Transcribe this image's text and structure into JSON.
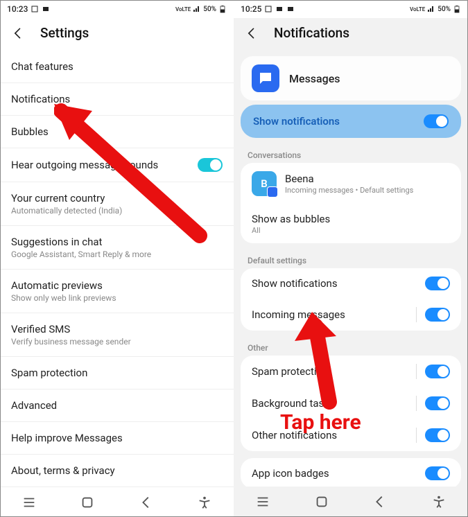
{
  "left": {
    "status": {
      "time": "10:23",
      "battery": "50%"
    },
    "header_title": "Settings",
    "rows": [
      {
        "label": "Chat features"
      },
      {
        "label": "Notifications"
      },
      {
        "label": "Bubbles"
      },
      {
        "label": "Hear outgoing message sounds",
        "toggle": true
      },
      {
        "label": "Your current country",
        "sub": "Automatically detected (India)"
      },
      {
        "label": "Suggestions in chat",
        "sub": "Google Assistant, Smart Reply & more"
      },
      {
        "label": "Automatic previews",
        "sub": "Show only web link previews"
      },
      {
        "label": "Verified SMS",
        "sub": "Verify business message sender"
      },
      {
        "label": "Spam protection"
      },
      {
        "label": "Advanced"
      },
      {
        "label": "Help improve Messages"
      },
      {
        "label": "About, terms & privacy"
      }
    ]
  },
  "right": {
    "status": {
      "time": "10:25",
      "battery": "50%"
    },
    "header_title": "Notifications",
    "app_name": "Messages",
    "show_notifications_label": "Show notifications",
    "section_conversations": "Conversations",
    "contact": {
      "initial": "B",
      "name": "Beena",
      "sub": "Incoming messages • Default settings"
    },
    "show_as_bubbles": {
      "label": "Show as bubbles",
      "sub": "All"
    },
    "section_default": "Default settings",
    "default_rows": [
      {
        "label": "Show notifications"
      },
      {
        "label": "Incoming messages"
      }
    ],
    "section_other": "Other",
    "other_rows": [
      {
        "label": "Spam protection"
      },
      {
        "label": "Background tasks"
      },
      {
        "label": "Other notifications"
      }
    ],
    "app_icon_badges": "App icon badges"
  },
  "annotation_text": "Tap here"
}
